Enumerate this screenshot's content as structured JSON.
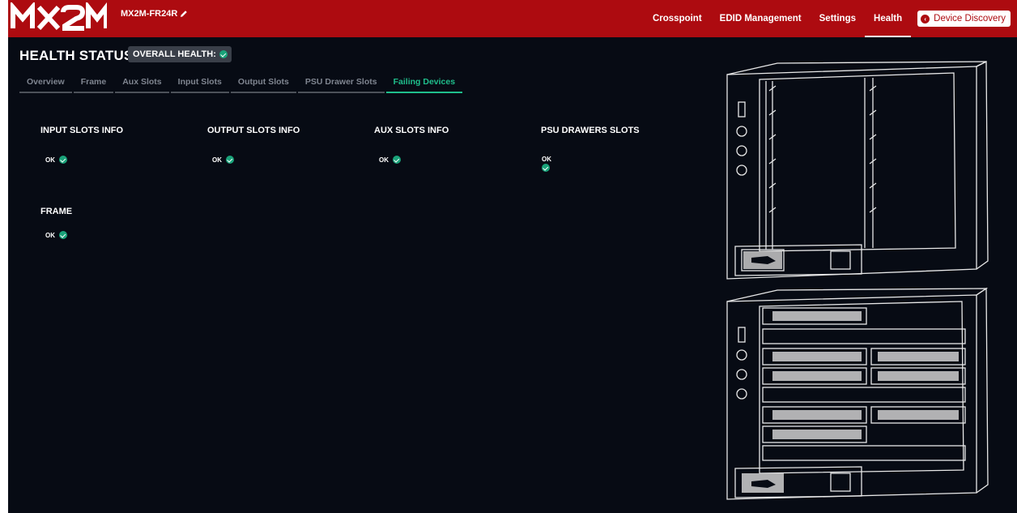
{
  "header": {
    "device_name": "MX2M-FR24R",
    "nav": [
      "Crosspoint",
      "EDID Management",
      "Settings",
      "Health"
    ],
    "active_nav": "Health",
    "device_discovery_label": "Device Discovery",
    "brand_color": "#ad0b10"
  },
  "page": {
    "title": "HEALTH STATUS",
    "overall_health_label": "OVERALL HEALTH:"
  },
  "tabs": [
    {
      "label": "Overview"
    },
    {
      "label": "Frame"
    },
    {
      "label": "Aux Slots"
    },
    {
      "label": "Input Slots"
    },
    {
      "label": "Output Slots"
    },
    {
      "label": "PSU Drawer Slots"
    },
    {
      "label": "Failing Devices",
      "active": true
    }
  ],
  "sections": {
    "input": {
      "title": "INPUT SLOTS INFO",
      "status": "OK"
    },
    "output": {
      "title": "OUTPUT SLOTS INFO",
      "status": "OK"
    },
    "aux": {
      "title": "AUX SLOTS INFO",
      "status": "OK"
    },
    "psu": {
      "title": "PSU DRAWERS SLOTS",
      "status": "OK"
    },
    "frame": {
      "title": "FRAME",
      "status": "OK"
    }
  },
  "status_color": "#1aa37a",
  "accent_color": "#1fbf8c"
}
